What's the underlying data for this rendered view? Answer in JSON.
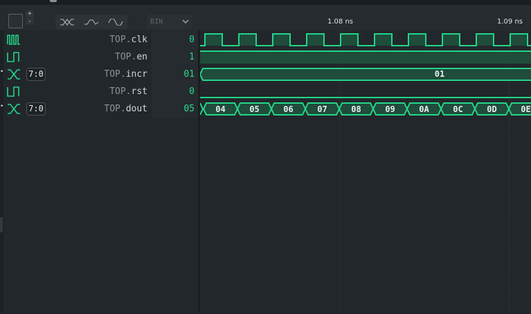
{
  "toolbar": {
    "zoom_in_label": "+",
    "zoom_out_label": "-",
    "radix_select_value": "BIN",
    "buttons": [
      {
        "name": "bus-format-button",
        "icon": "bus-icon"
      },
      {
        "name": "analog-format-button",
        "icon": "step-wave-icon"
      },
      {
        "name": "sine-format-button",
        "icon": "sine-wave-icon"
      }
    ]
  },
  "timeline": {
    "labels": [
      "1.08 ns",
      "1.09 ns"
    ]
  },
  "signals": [
    {
      "scope": "TOP.",
      "name": "clk",
      "value": "0",
      "kind": "clock",
      "badge": ""
    },
    {
      "scope": "TOP.",
      "name": "en",
      "value": "1",
      "kind": "bit",
      "badge": ""
    },
    {
      "scope": "TOP.",
      "name": "incr",
      "value": "01",
      "kind": "bus",
      "badge": "7:0"
    },
    {
      "scope": "TOP.",
      "name": "rst",
      "value": "0",
      "kind": "bit",
      "badge": ""
    },
    {
      "scope": "TOP.",
      "name": "dout",
      "value": "05",
      "kind": "bus",
      "badge": "7:0"
    }
  ],
  "waves": {
    "incr_segment_value": "01",
    "dout_values": [
      "04",
      "05",
      "06",
      "07",
      "08",
      "09",
      "0A",
      "0C",
      "0D",
      "0E"
    ]
  },
  "colors": {
    "wave": "#23d688",
    "wave_fill": "#1f4c3b",
    "background": "#22272b"
  }
}
